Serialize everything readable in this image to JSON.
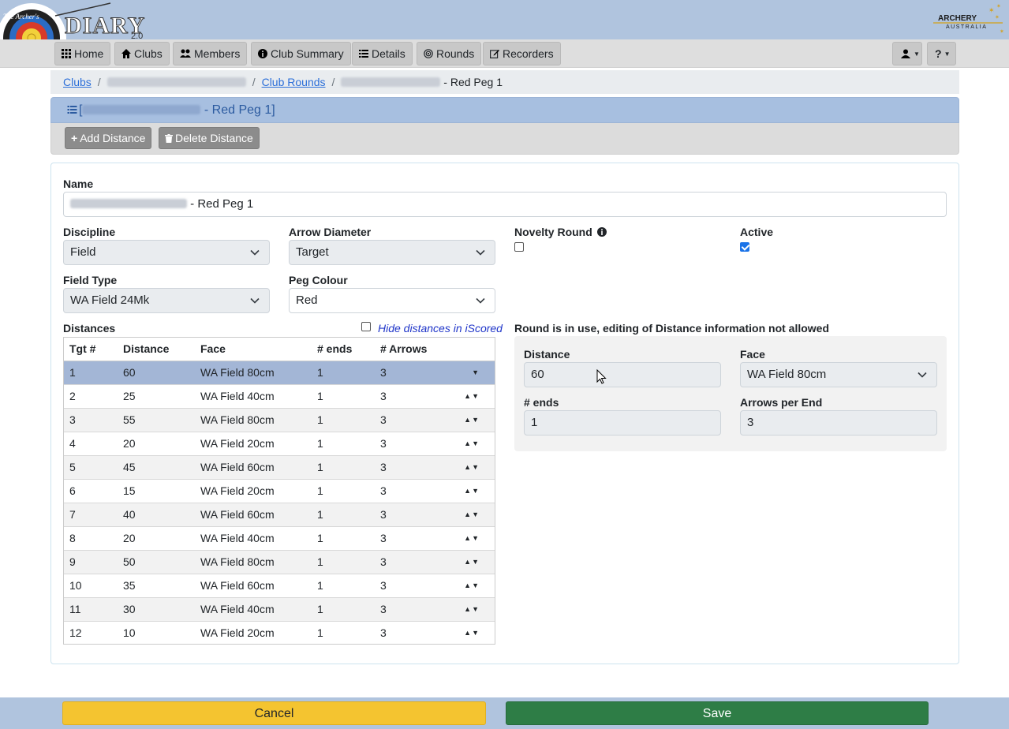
{
  "header": {
    "logo_text": "The Archer's DIARY",
    "logo_version": "2.0",
    "partner_logo_text": "ARCHERY AUSTRALIA"
  },
  "nav": {
    "items": [
      {
        "label": "Home",
        "icon": "grid-icon"
      },
      {
        "label": "Clubs",
        "icon": "home-icon"
      },
      {
        "label": "Members",
        "icon": "users-icon"
      },
      {
        "label": "Club Summary",
        "icon": "info-icon"
      },
      {
        "label": "Details",
        "icon": "list-icon"
      },
      {
        "label": "Rounds",
        "icon": "target-icon"
      },
      {
        "label": "Recorders",
        "icon": "edit-icon"
      }
    ],
    "user_menu_icon": "user-icon",
    "help_menu_label": "?"
  },
  "breadcrumb": {
    "clubs": "Clubs",
    "club_rounds": "Club Rounds",
    "current_suffix": "- Red Peg 1"
  },
  "card": {
    "title_prefix": "[",
    "title_suffix": "- Red Peg 1]",
    "add_distance": "Add Distance",
    "delete_distance": "Delete Distance"
  },
  "form": {
    "name_label": "Name",
    "name_value_suffix": "- Red Peg 1",
    "discipline_label": "Discipline",
    "discipline_value": "Field",
    "arrow_diameter_label": "Arrow Diameter",
    "arrow_diameter_value": "Target",
    "novelty_label": "Novelty Round",
    "novelty_checked": false,
    "active_label": "Active",
    "active_checked": true,
    "field_type_label": "Field Type",
    "field_type_value": "WA Field 24Mk",
    "peg_colour_label": "Peg Colour",
    "peg_colour_value": "Red"
  },
  "distances": {
    "label": "Distances",
    "hide_label": "Hide distances in iScored",
    "hide_checked": false,
    "columns": [
      "Tgt #",
      "Distance",
      "Face",
      "# ends",
      "# Arrows"
    ],
    "rows": [
      [
        "1",
        "60",
        "WA Field 80cm",
        "1",
        "3"
      ],
      [
        "2",
        "25",
        "WA Field 40cm",
        "1",
        "3"
      ],
      [
        "3",
        "55",
        "WA Field 80cm",
        "1",
        "3"
      ],
      [
        "4",
        "20",
        "WA Field 20cm",
        "1",
        "3"
      ],
      [
        "5",
        "45",
        "WA Field 60cm",
        "1",
        "3"
      ],
      [
        "6",
        "15",
        "WA Field 20cm",
        "1",
        "3"
      ],
      [
        "7",
        "40",
        "WA Field 60cm",
        "1",
        "3"
      ],
      [
        "8",
        "20",
        "WA Field 40cm",
        "1",
        "3"
      ],
      [
        "9",
        "50",
        "WA Field 80cm",
        "1",
        "3"
      ],
      [
        "10",
        "35",
        "WA Field 60cm",
        "1",
        "3"
      ],
      [
        "11",
        "30",
        "WA Field 40cm",
        "1",
        "3"
      ],
      [
        "12",
        "10",
        "WA Field 20cm",
        "1",
        "3"
      ]
    ]
  },
  "edit": {
    "notice": "Round is in use, editing of Distance information not allowed",
    "distance_label": "Distance",
    "distance_value": "60",
    "face_label": "Face",
    "face_value": "WA Field 80cm",
    "ends_label": "# ends",
    "ends_value": "1",
    "arrows_label": "Arrows per End",
    "arrows_value": "3"
  },
  "footer": {
    "cancel": "Cancel",
    "save": "Save"
  },
  "colors": {
    "topbar": "#b0c4de",
    "cancel": "#f4c430",
    "save": "#2e7d46",
    "selected_row": "#a3b6d6"
  }
}
